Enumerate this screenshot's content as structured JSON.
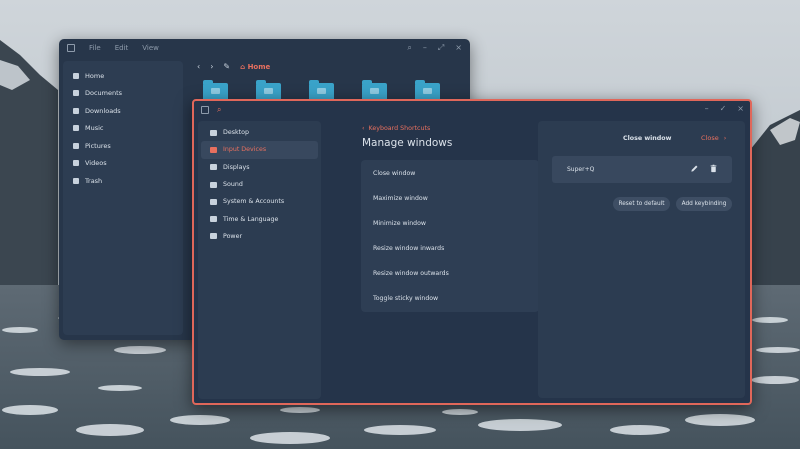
{
  "file_manager": {
    "menu": [
      "File",
      "Edit",
      "View"
    ],
    "window_controls": [
      "⌕",
      "–",
      "⤢",
      "×"
    ],
    "nav": {
      "back": "‹",
      "forward": "›",
      "edit": "✎",
      "location": "Home"
    },
    "sidebar": [
      {
        "label": "Home",
        "icon": "home-icon"
      },
      {
        "label": "Documents",
        "icon": "document-icon"
      },
      {
        "label": "Downloads",
        "icon": "download-icon"
      },
      {
        "label": "Music",
        "icon": "music-icon"
      },
      {
        "label": "Pictures",
        "icon": "picture-icon"
      },
      {
        "label": "Videos",
        "icon": "video-icon"
      },
      {
        "label": "Trash",
        "icon": "trash-icon"
      }
    ],
    "folder_color": "#3aa3c9"
  },
  "settings": {
    "accent": "#e8705f",
    "search_icon": "⌕",
    "window_controls": [
      "–",
      "✓",
      "×"
    ],
    "sidebar": [
      {
        "label": "Desktop",
        "icon": "desktop-icon"
      },
      {
        "label": "Input Devices",
        "icon": "keyboard-icon",
        "active": true
      },
      {
        "label": "Displays",
        "icon": "display-icon"
      },
      {
        "label": "Sound",
        "icon": "sound-icon"
      },
      {
        "label": "System & Accounts",
        "icon": "users-icon"
      },
      {
        "label": "Time & Language",
        "icon": "clock-icon"
      },
      {
        "label": "Power",
        "icon": "power-icon"
      }
    ],
    "breadcrumb": "Keyboard Shortcuts",
    "breadcrumb_chevron": "‹",
    "heading": "Manage windows",
    "shortcuts": [
      "Close window",
      "Maximize window",
      "Minimize window",
      "Resize window inwards",
      "Resize window outwards",
      "Toggle sticky window"
    ],
    "detail": {
      "title": "Close window",
      "close_label": "Close",
      "close_chevron": "›",
      "keybinding": "Super+Q",
      "reset_label": "Reset to default",
      "add_label": "Add keybinding"
    }
  }
}
